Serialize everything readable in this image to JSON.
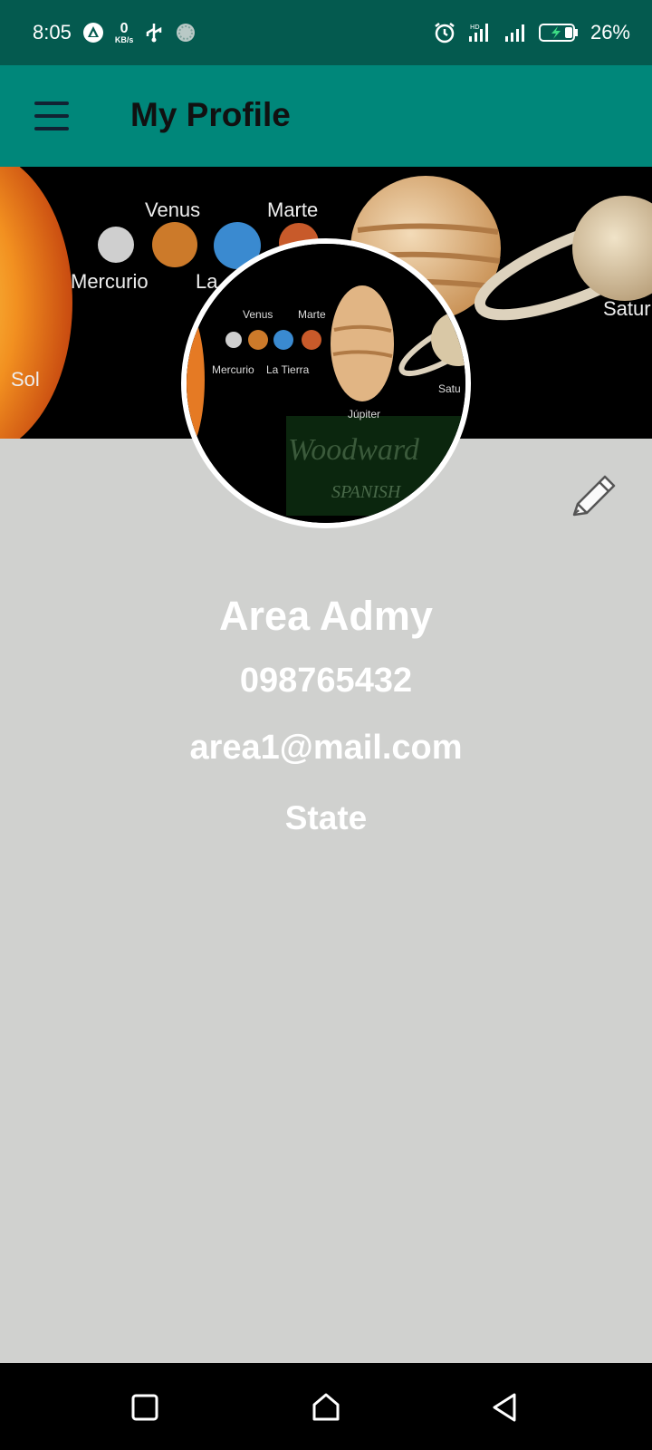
{
  "status_bar": {
    "time": "8:05",
    "kbs_value": "0",
    "kbs_unit": "KB/s",
    "battery_percent": "26%",
    "icons": [
      "vpn-icon",
      "network-speed",
      "usb-icon",
      "sync-icon",
      "alarm-icon",
      "hd-signal-icon",
      "signal-icon",
      "battery-charging-icon"
    ]
  },
  "app_bar": {
    "title": "My Profile",
    "menu_icon": "hamburger-menu-icon"
  },
  "banner": {
    "labels": [
      "Venus",
      "Marte",
      "Mercurio",
      "La",
      "Sol",
      "Satur"
    ]
  },
  "avatar": {
    "labels": [
      "Venus",
      "Marte",
      "Mercurio",
      "La Tierra",
      "Júpiter",
      "Satu",
      "Woodward",
      "SPANISH"
    ]
  },
  "profile": {
    "name": "Area Admy",
    "phone": "098765432",
    "email": "area1@mail.com",
    "state": "State",
    "edit_icon": "pencil-icon"
  },
  "nav": {
    "icons": [
      "recents-square-icon",
      "home-icon",
      "back-triangle-icon"
    ]
  },
  "colors": {
    "status_bar": "#045a4f",
    "app_bar": "#00877a",
    "background": "#d0d1cf",
    "nav_bar": "#000000"
  }
}
